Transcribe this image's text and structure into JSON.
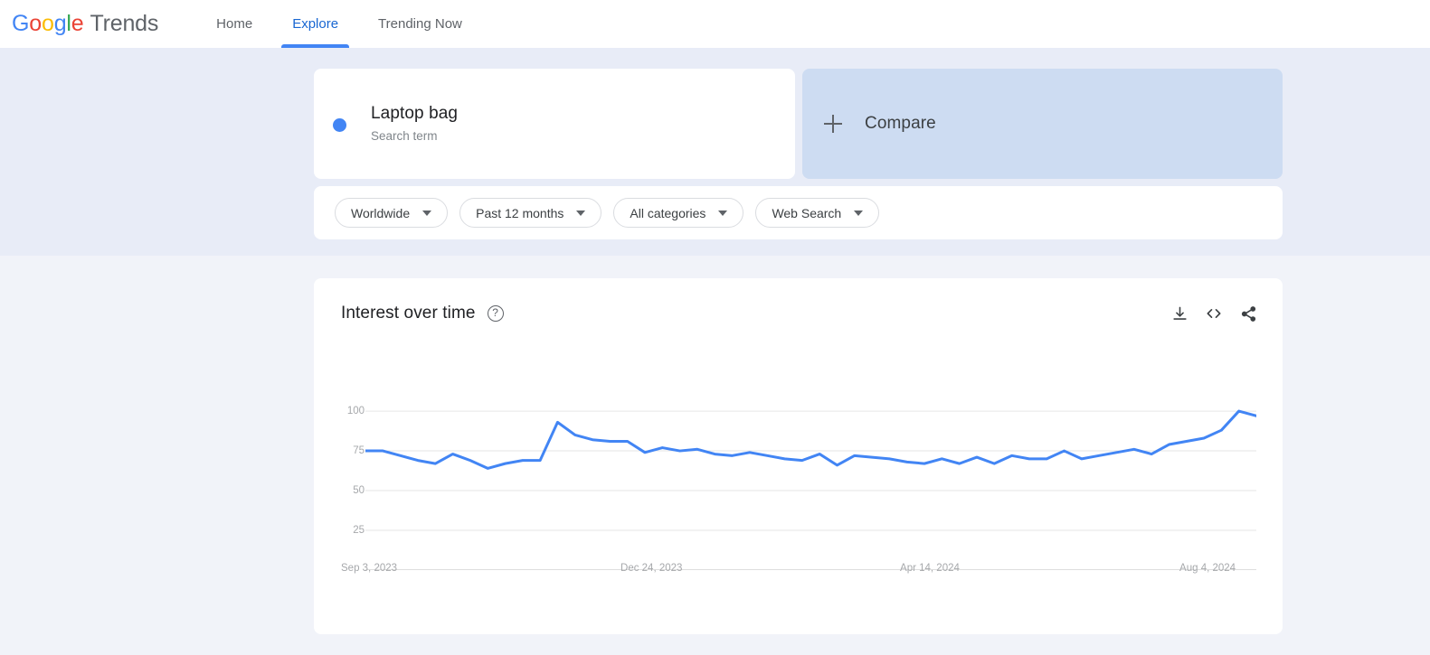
{
  "header": {
    "logo": {
      "word1": "Google",
      "word2": "Trends"
    },
    "nav": [
      {
        "label": "Home",
        "active": false
      },
      {
        "label": "Explore",
        "active": true
      },
      {
        "label": "Trending Now",
        "active": false
      }
    ]
  },
  "query": {
    "term": {
      "title": "Laptop bag",
      "subtitle": "Search term",
      "color": "#4285f4"
    },
    "compare": {
      "label": "Compare",
      "icon": "plus-icon"
    }
  },
  "filters": [
    {
      "label": "Worldwide"
    },
    {
      "label": "Past 12 months"
    },
    {
      "label": "All categories"
    },
    {
      "label": "Web Search"
    }
  ],
  "chart_card": {
    "title": "Interest over time",
    "help_icon": "?",
    "actions": [
      {
        "name": "download-icon"
      },
      {
        "name": "embed-icon"
      },
      {
        "name": "share-icon"
      }
    ]
  },
  "chart_data": {
    "type": "line",
    "title": "Interest over time",
    "xlabel": "",
    "ylabel": "",
    "ylim": [
      0,
      108
    ],
    "yticks": [
      25,
      50,
      75,
      100
    ],
    "ytick_labels": [
      "25",
      "50",
      "75",
      "100"
    ],
    "grid": true,
    "legend": false,
    "line_color": "#4285f4",
    "series_name": "Laptop bag",
    "xtick_labels": [
      "Sep 3, 2023",
      "Dec 24, 2023",
      "Apr 14, 2024",
      "Aug 4, 2024"
    ],
    "xtick_index": [
      0,
      16,
      32,
      48
    ],
    "x": [
      "Sep 3, 2023",
      "Sep 10, 2023",
      "Sep 17, 2023",
      "Sep 24, 2023",
      "Oct 1, 2023",
      "Oct 8, 2023",
      "Oct 15, 2023",
      "Oct 22, 2023",
      "Oct 29, 2023",
      "Nov 5, 2023",
      "Nov 12, 2023",
      "Nov 19, 2023",
      "Nov 26, 2023",
      "Dec 3, 2023",
      "Dec 10, 2023",
      "Dec 17, 2023",
      "Dec 24, 2023",
      "Dec 31, 2023",
      "Jan 7, 2024",
      "Jan 14, 2024",
      "Jan 21, 2024",
      "Jan 28, 2024",
      "Feb 4, 2024",
      "Feb 11, 2024",
      "Feb 18, 2024",
      "Feb 25, 2024",
      "Mar 3, 2024",
      "Mar 10, 2024",
      "Mar 17, 2024",
      "Mar 24, 2024",
      "Mar 31, 2024",
      "Apr 7, 2024",
      "Apr 14, 2024",
      "Apr 21, 2024",
      "Apr 28, 2024",
      "May 5, 2024",
      "May 12, 2024",
      "May 19, 2024",
      "May 26, 2024",
      "Jun 2, 2024",
      "Jun 9, 2024",
      "Jun 16, 2024",
      "Jun 23, 2024",
      "Jun 30, 2024",
      "Jul 7, 2024",
      "Jul 14, 2024",
      "Jul 21, 2024",
      "Jul 28, 2024",
      "Aug 4, 2024",
      "Aug 11, 2024",
      "Aug 18, 2024",
      "Aug 25, 2024"
    ],
    "values": [
      75,
      75,
      72,
      69,
      67,
      73,
      69,
      64,
      67,
      69,
      69,
      93,
      85,
      82,
      81,
      81,
      74,
      77,
      75,
      76,
      73,
      72,
      74,
      72,
      70,
      69,
      73,
      66,
      72,
      71,
      70,
      68,
      67,
      70,
      67,
      71,
      67,
      72,
      70,
      70,
      75,
      70,
      72,
      74,
      76,
      73,
      79,
      81,
      83,
      88,
      100,
      97
    ]
  }
}
